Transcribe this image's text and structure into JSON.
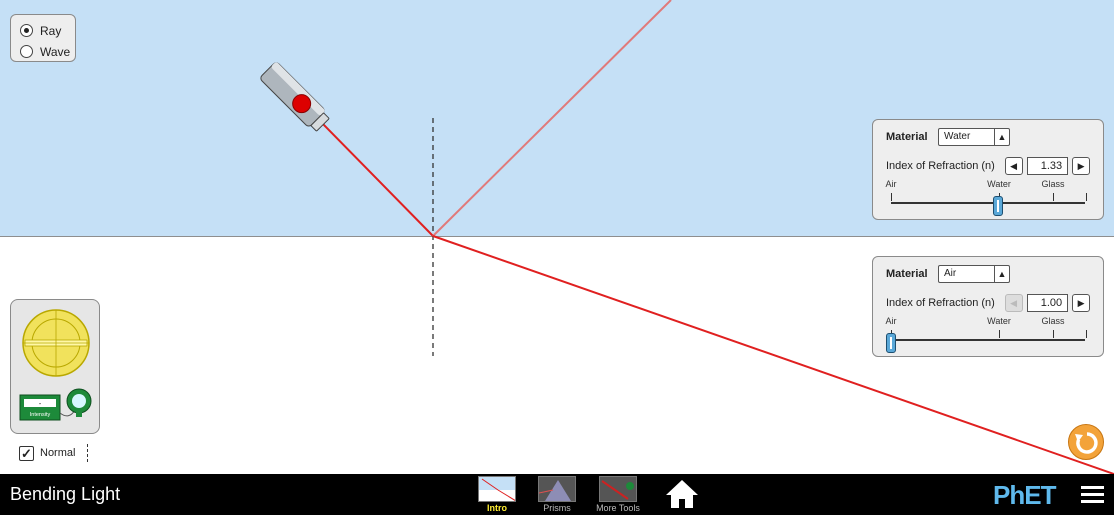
{
  "mode_panel": {
    "options": [
      {
        "label": "Ray",
        "selected": true
      },
      {
        "label": "Wave",
        "selected": false
      }
    ]
  },
  "top_medium": {
    "material_label": "Material",
    "material_value": "Water",
    "ior_label": "Index of Refraction (n)",
    "ior_value": "1.33",
    "slider_labels": {
      "air": "Air",
      "water": "Water",
      "glass": "Glass"
    },
    "slider_level": 0.33,
    "decrement_enabled": true
  },
  "bottom_medium": {
    "material_label": "Material",
    "material_value": "Air",
    "ior_label": "Index of Refraction (n)",
    "ior_value": "1.00",
    "slider_labels": {
      "air": "Air",
      "water": "Water",
      "glass": "Glass"
    },
    "slider_level": 0.0,
    "decrement_enabled": false
  },
  "toolbox": {
    "intensity_meter_label": "Intensity",
    "intensity_readout": "-"
  },
  "normal_checkbox": {
    "label": "Normal",
    "checked": true
  },
  "navbar": {
    "title": "Bending Light",
    "screens": [
      {
        "label": "Intro",
        "active": true
      },
      {
        "label": "Prisms",
        "active": false
      },
      {
        "label": "More Tools",
        "active": false
      }
    ],
    "logo": "PhET"
  },
  "colors": {
    "top_medium": "#c5e0f6",
    "ray": "#e02020",
    "reflected_ray": "#e07a7a",
    "reset": "#f3a33a",
    "slider_thumb": "#5aa8d8"
  }
}
